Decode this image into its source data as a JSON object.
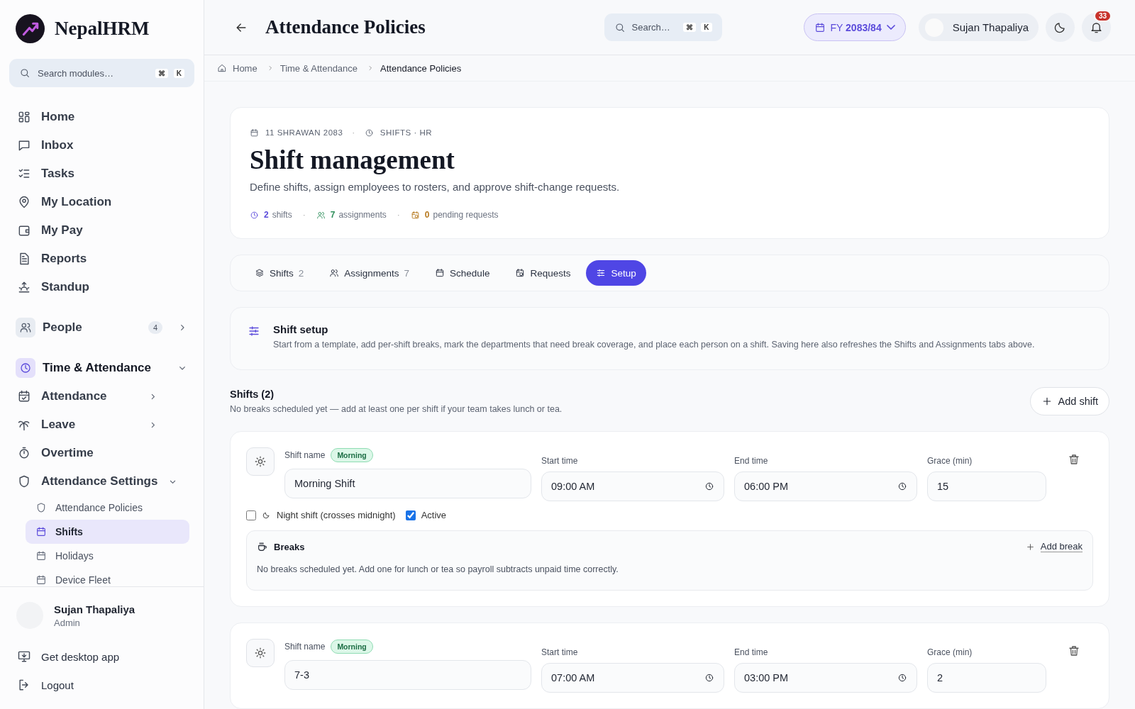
{
  "brand": {
    "name": "NepalHRM"
  },
  "sidebar": {
    "search": {
      "placeholder": "Search modules…",
      "keys": [
        "⌘",
        "K"
      ]
    },
    "links": [
      {
        "label": "Home"
      },
      {
        "label": "Inbox"
      },
      {
        "label": "Tasks"
      },
      {
        "label": "My Location"
      },
      {
        "label": "My Pay"
      },
      {
        "label": "Reports"
      },
      {
        "label": "Standup"
      }
    ],
    "groups": [
      {
        "label": "People",
        "badge": "4",
        "expanded": false
      },
      {
        "label": "Time & Attendance",
        "expanded": true,
        "children": [
          {
            "label": "Attendance",
            "expanded": false
          },
          {
            "label": "Leave",
            "expanded": false
          },
          {
            "label": "Overtime"
          },
          {
            "label": "Attendance Settings",
            "expanded": true,
            "children": [
              {
                "label": "Attendance Policies",
                "selected": false
              },
              {
                "label": "Shifts",
                "selected": true
              },
              {
                "label": "Holidays",
                "selected": false
              },
              {
                "label": "Device Fleet",
                "selected": false
              }
            ]
          }
        ]
      }
    ],
    "user": {
      "name": "Sujan Thapaliya",
      "role": "Admin"
    },
    "footer_links": [
      {
        "label": "Get desktop app"
      },
      {
        "label": "Logout"
      }
    ]
  },
  "header": {
    "title": "Attendance Policies",
    "search": {
      "placeholder": "Search…",
      "keys": [
        "⌘",
        "K"
      ]
    },
    "fiscal_year": {
      "prefix": "FY",
      "value": "2083/84"
    },
    "user_name": "Sujan Thapaliya",
    "notifications": "33"
  },
  "breadcrumb": [
    "Home",
    "Time & Attendance",
    "Attendance Policies"
  ],
  "hero": {
    "date": "11 SHRAWAN 2083",
    "meta_separator": "·",
    "context": "SHIFTS · HR",
    "title": "Shift management",
    "subtitle": "Define shifts, assign employees to rosters, and approve shift-change requests.",
    "stats": [
      {
        "value": "2",
        "label": "shifts",
        "color": "#5b4bdb"
      },
      {
        "separator": "·",
        "value": "7",
        "label": "assignments",
        "color": "#2f8f5b"
      },
      {
        "separator": "·",
        "value": "0",
        "label": "pending requests",
        "color": "#b7791f"
      }
    ]
  },
  "tabs": [
    {
      "label": "Shifts",
      "count": "2",
      "selected": false
    },
    {
      "label": "Assignments",
      "count": "7",
      "selected": false
    },
    {
      "label": "Schedule",
      "selected": false
    },
    {
      "label": "Requests",
      "selected": false
    },
    {
      "label": "Setup",
      "selected": true
    }
  ],
  "setup": {
    "title": "Shift setup",
    "text": "Start from a template, add per-shift breaks, mark the departments that need break coverage, and place each person on a shift. Saving here also refreshes the Shifts and Assignments tabs above."
  },
  "shifts_section": {
    "title": "Shifts (2)",
    "hint": "No breaks scheduled yet — add at least one per shift if your team takes lunch or tea.",
    "add_button": "Add shift",
    "shifts": [
      {
        "labels": {
          "name": "Shift name",
          "start": "Start time",
          "end": "End time",
          "grace": "Grace (min)"
        },
        "tag": "Morning",
        "name": "Morning Shift",
        "start": "09:00 AM",
        "end": "06:00 PM",
        "grace": "15",
        "options": [
          {
            "label": "Night shift (crosses midnight)",
            "checked": false
          },
          {
            "label": "Active",
            "checked": true
          }
        ],
        "breaks": {
          "title": "Breaks",
          "add": "Add break",
          "empty": "No breaks scheduled yet. Add one for lunch or tea so payroll subtracts unpaid time correctly."
        }
      },
      {
        "labels": {
          "name": "Shift name",
          "start": "Start time",
          "end": "End time",
          "grace": "Grace (min)"
        },
        "tag": "Morning",
        "name": "7-3",
        "start": "07:00 AM",
        "end": "03:00 PM",
        "grace": "2"
      }
    ]
  }
}
